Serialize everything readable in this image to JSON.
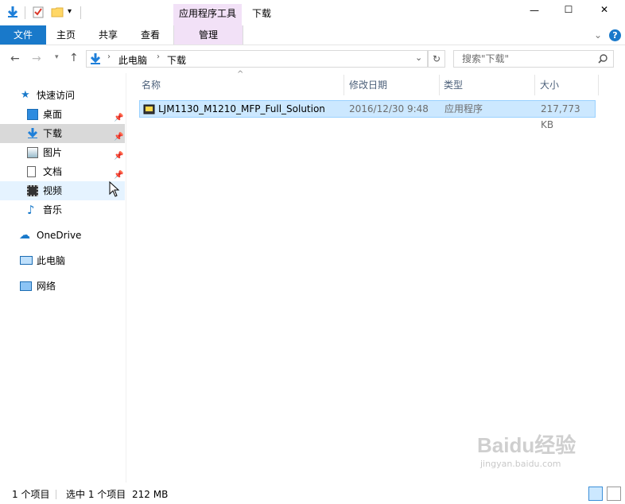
{
  "window": {
    "current_folder": "下载",
    "contextual_group": "应用程序工具",
    "controls": [
      "—",
      "☐",
      "✕"
    ]
  },
  "ribbon": {
    "tabs": [
      "文件",
      "主页",
      "共享",
      "查看",
      "管理"
    ]
  },
  "address": {
    "breadcrumb": [
      "此电脑",
      "下载"
    ],
    "search_placeholder": "搜索\"下载\""
  },
  "nav": {
    "quick_access": "快速访问",
    "items": [
      {
        "label": "桌面",
        "icon": "desktop-icon",
        "pinned": true
      },
      {
        "label": "下载",
        "icon": "download-icon",
        "pinned": true
      },
      {
        "label": "图片",
        "icon": "pictures-icon",
        "pinned": true
      },
      {
        "label": "文档",
        "icon": "documents-icon",
        "pinned": true
      },
      {
        "label": "视频",
        "icon": "videos-icon",
        "pinned": false
      },
      {
        "label": "音乐",
        "icon": "music-icon",
        "pinned": false
      }
    ],
    "onedrive": "OneDrive",
    "this_pc": "此电脑",
    "network": "网络"
  },
  "columns": [
    "名称",
    "修改日期",
    "类型",
    "大小"
  ],
  "files": [
    {
      "name": "LJM1130_M1210_MFP_Full_Solution",
      "date": "2016/12/30 9:48",
      "type": "应用程序",
      "size": "217,773 KB"
    }
  ],
  "status": {
    "count": "1 个项目",
    "selected": "选中 1 个项目",
    "size": "212 MB"
  },
  "watermark": {
    "brand": "Baidu经验",
    "url": "jingyan.baidu.com"
  },
  "colors": {
    "accent": "#1979ca",
    "selection": "#cce8ff",
    "contextual": "#f2e1f7"
  }
}
